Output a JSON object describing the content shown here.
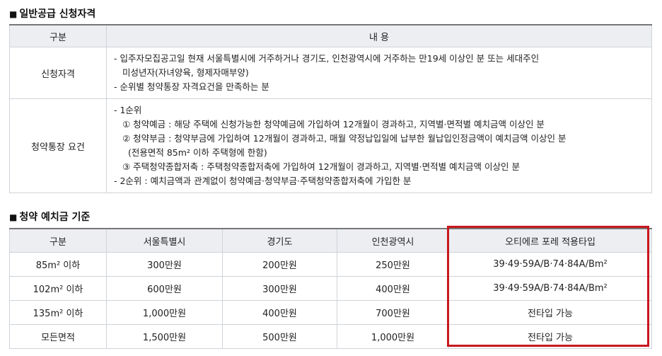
{
  "section1": {
    "title": "일반공급 신청자격",
    "headers": [
      "구분",
      "내 용"
    ],
    "rows": [
      {
        "label": "신청자격",
        "lines": [
          "- 입주자모집공고일 현재 서울특별시에 거주하거나 경기도, 인천광역시에 거주하는 만19세 이상인 분 또는 세대주인",
          "미성년자(자녀양육, 형제자매부양)",
          "- 순위별 청약통장 자격요건을 만족하는 분"
        ]
      },
      {
        "label": "청약통장 요건",
        "lines": [
          "- 1순위",
          "① 청약예금 : 해당 주택에 신청가능한 청약예금에 가입하여 12개월이 경과하고, 지역별·면적별 예치금액 이상인 분",
          "② 청약부금 : 청약부금에 가입하여 12개월이 경과하고, 매월 약정납입일에 납부한 월납입인정금액이 예치금액 이상인 분",
          "(전용면적 85m² 이하 주택형에 한함)",
          "③ 주택청약종합저축 : 주택청약종합저축에 가입하여 12개월이 경과하고, 지역별·면적별 예치금액 이상인 분",
          "- 2순위 : 예치금액과 관계없이 청약예금·청약부금·주택청약종합저축에 가입한 분"
        ]
      }
    ]
  },
  "section2": {
    "title": "청약 예치금 기준",
    "headers": [
      "구분",
      "서울특별시",
      "경기도",
      "인천광역시",
      "오티에르 포레 적용타입"
    ],
    "rows": [
      [
        "85m² 이하",
        "300만원",
        "200만원",
        "250만원",
        "39·49·59A/B·74·84A/Bm²"
      ],
      [
        "102m² 이하",
        "600만원",
        "300만원",
        "400만원",
        "39·49·59A/B·74·84A/Bm²"
      ],
      [
        "135m² 이하",
        "1,000만원",
        "400만원",
        "700만원",
        "전타입 가능"
      ],
      [
        "모든면적",
        "1,500만원",
        "500만원",
        "1,000만원",
        "전타입 가능"
      ]
    ]
  },
  "colors": {
    "highlight": "#c8171e",
    "header_bg": "#eceef2"
  }
}
